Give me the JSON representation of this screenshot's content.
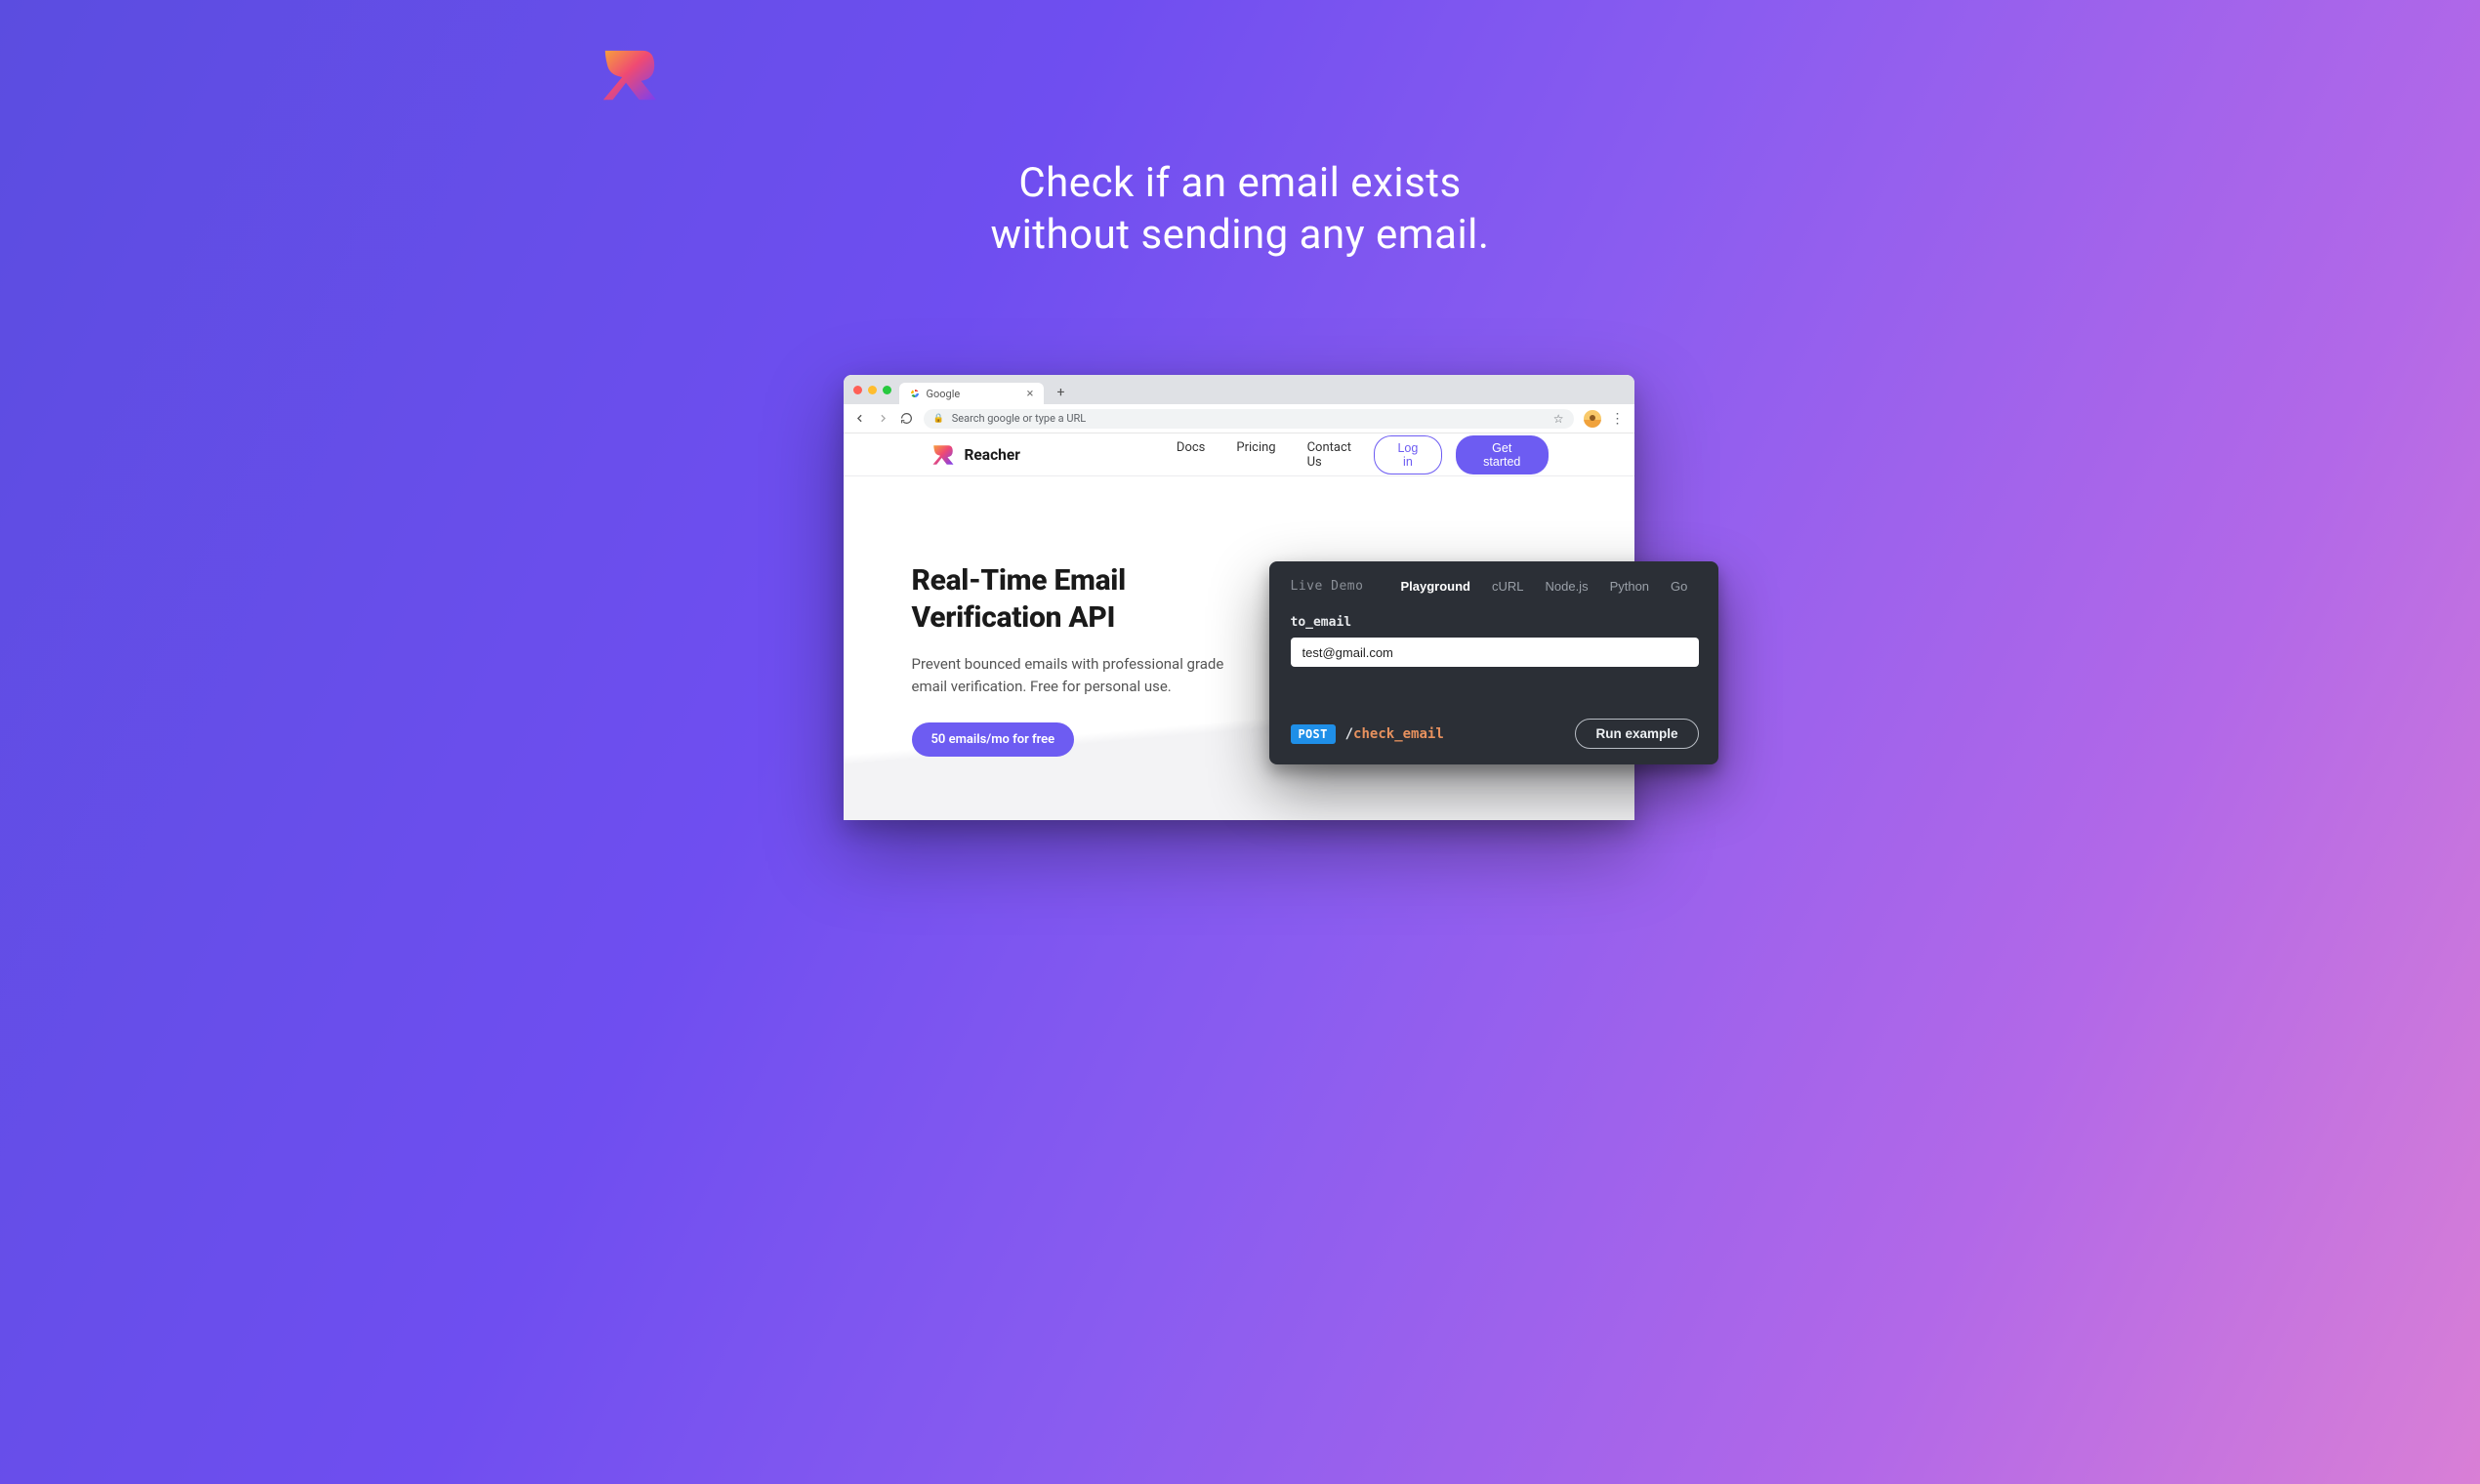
{
  "headline_l1": "Check if an email exists",
  "headline_l2": "without sending any email.",
  "browser": {
    "tab_title": "Google",
    "omnibox_placeholder": "Search google or type a URL"
  },
  "site": {
    "brand": "Reacher",
    "nav": {
      "docs": "Docs",
      "pricing": "Pricing",
      "contact": "Contact Us"
    },
    "login": "Log in",
    "get_started": "Get started"
  },
  "hero": {
    "title_l1": "Real-Time Email",
    "title_l2": "Verification API",
    "subtitle": "Prevent bounced emails with professional grade email verification. Free for personal use.",
    "cta": "50 emails/mo for free"
  },
  "demo": {
    "label": "Live Demo",
    "tabs": {
      "playground": "Playground",
      "curl": "cURL",
      "node": "Node.js",
      "python": "Python",
      "go": "Go"
    },
    "field_label": "to_email",
    "input_value": "test@gmail.com",
    "method": "POST",
    "endpoint": "check_email",
    "run": "Run example"
  }
}
